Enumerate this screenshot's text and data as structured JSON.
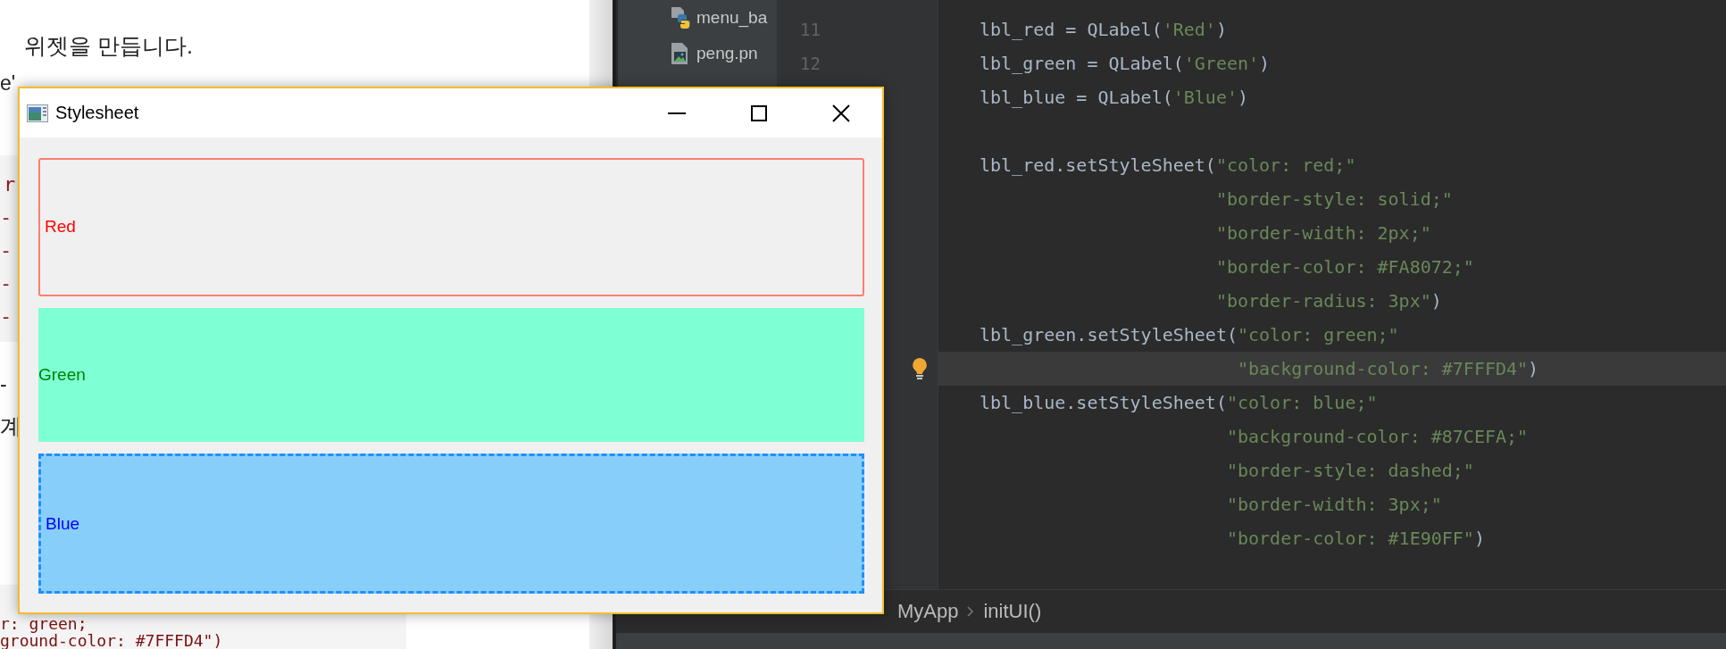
{
  "browser_page": {
    "heading": "위젯을 만듭니다.",
    "line_2": "e'",
    "code_block": [
      "r",
      "-",
      "-",
      "-",
      "-"
    ],
    "line_3": "-",
    "line_4": "계",
    "bottom_code": [
      "r: green;",
      "ground-color: #7FFFD4\")"
    ]
  },
  "ide": {
    "project_tree": [
      {
        "name": "menu_ba",
        "kind": "python"
      },
      {
        "name": "peng.pn",
        "kind": "image"
      }
    ],
    "line_numbers": [
      "11",
      "12"
    ],
    "code_lines": [
      {
        "kind": "statement",
        "current": false,
        "segments": [
          {
            "kind": "code",
            "text": "lbl_red = QLabel("
          },
          {
            "kind": "string",
            "text": "'Red'"
          },
          {
            "kind": "code",
            "text": ")"
          }
        ]
      },
      {
        "kind": "statement",
        "current": false,
        "segments": [
          {
            "kind": "code",
            "text": "lbl_green = QLabel("
          },
          {
            "kind": "string",
            "text": "'Green'"
          },
          {
            "kind": "code",
            "text": ")"
          }
        ]
      },
      {
        "kind": "statement",
        "current": false,
        "segments": [
          {
            "kind": "code",
            "text": "lbl_blue = QLabel("
          },
          {
            "kind": "string",
            "text": "'Blue'"
          },
          {
            "kind": "code",
            "text": ")"
          }
        ]
      },
      {
        "kind": "blank",
        "current": false
      },
      {
        "kind": "statement",
        "current": false,
        "segments": [
          {
            "kind": "code",
            "text": "lbl_red.setStyleSheet("
          },
          {
            "kind": "string",
            "text": "\"color: red;\""
          }
        ]
      },
      {
        "kind": "continuation",
        "current": false,
        "segments": [
          {
            "kind": "string",
            "text": "\"border-style: solid;\""
          }
        ]
      },
      {
        "kind": "continuation",
        "current": false,
        "segments": [
          {
            "kind": "string",
            "text": "\"border-width: 2px;\""
          }
        ]
      },
      {
        "kind": "continuation",
        "current": false,
        "segments": [
          {
            "kind": "string",
            "text": "\"border-color: #FA8072;\""
          }
        ]
      },
      {
        "kind": "continuation",
        "current": false,
        "segments": [
          {
            "kind": "string",
            "text": "\"border-radius: 3px\""
          },
          {
            "kind": "code",
            "text": ")"
          }
        ]
      },
      {
        "kind": "statement",
        "current": false,
        "segments": [
          {
            "kind": "code",
            "text": "lbl_green.setStyleSheet("
          },
          {
            "kind": "string",
            "text": "\"color: green;\""
          }
        ]
      },
      {
        "kind": "continuation",
        "current": true,
        "segments": [
          {
            "kind": "string",
            "text": "\"background-color: #7FFFD4\""
          },
          {
            "kind": "code",
            "text": ")"
          }
        ]
      },
      {
        "kind": "statement",
        "current": false,
        "segments": [
          {
            "kind": "code",
            "text": "lbl_blue.setStyleSheet("
          },
          {
            "kind": "string",
            "text": "\"color: blue;\""
          }
        ]
      },
      {
        "kind": "continuation",
        "current": false,
        "segments": [
          {
            "kind": "string",
            "text": "\"background-color: #87CEFA;\""
          }
        ]
      },
      {
        "kind": "continuation",
        "current": false,
        "segments": [
          {
            "kind": "string",
            "text": "\"border-style: dashed;\""
          }
        ]
      },
      {
        "kind": "continuation",
        "current": false,
        "segments": [
          {
            "kind": "string",
            "text": "\"border-width: 3px;\""
          }
        ]
      },
      {
        "kind": "continuation",
        "current": false,
        "segments": [
          {
            "kind": "string",
            "text": "\"border-color: #1E90FF\""
          },
          {
            "kind": "code",
            "text": ")"
          }
        ]
      }
    ],
    "breadcrumb": [
      "MyApp",
      "initUI()"
    ]
  },
  "window": {
    "title": "Stylesheet",
    "labels": [
      {
        "text": "Red",
        "color": "#ff0000",
        "kind": "outlined"
      },
      {
        "text": "Green",
        "color": "#008000",
        "kind": "filled"
      },
      {
        "text": "Blue",
        "color": "#0000ff",
        "kind": "dashed"
      }
    ]
  }
}
